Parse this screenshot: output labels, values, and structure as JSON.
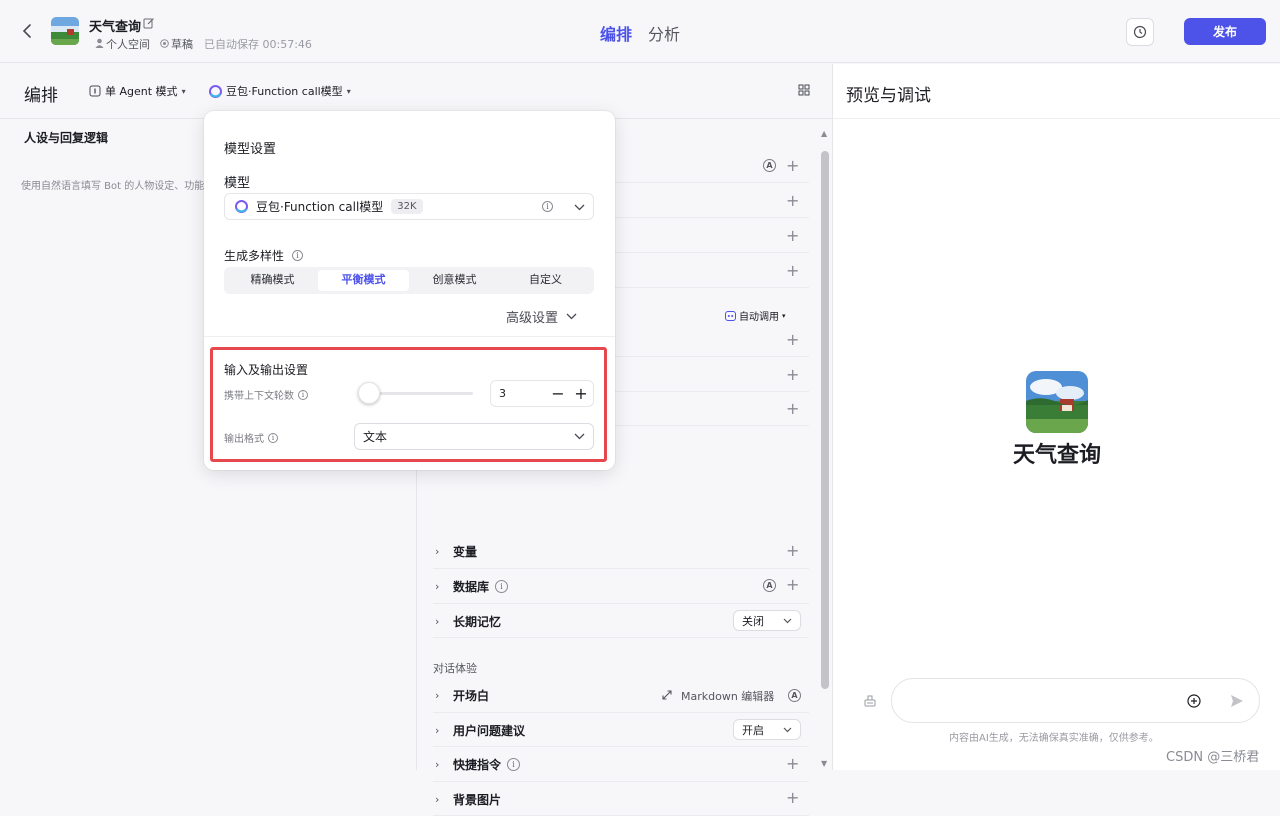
{
  "header": {
    "bot_name": "天气查询",
    "space": "个人空间",
    "status": "草稿",
    "autosave": "已自动保存 00:57:46",
    "tabs": [
      "编排",
      "分析"
    ],
    "publish_label": "发布"
  },
  "toolbar": {
    "title": "编排",
    "mode_label": "单 Agent 模式",
    "model_label": "豆包·Function call模型"
  },
  "left_section": {
    "title": "人设与回复逻辑",
    "placeholder": "使用自然语言填写 Bot 的人物设定、功能"
  },
  "skills": {
    "auto_call_label": "自动调用",
    "rows": [
      {
        "label": "变量"
      },
      {
        "label": "数据库"
      },
      {
        "label": "长期记忆",
        "select": "关闭"
      }
    ],
    "dialog_section_title": "对话体验",
    "dialog_rows": [
      {
        "label": "开场白",
        "extra": "Markdown 编辑器"
      },
      {
        "label": "用户问题建议",
        "select": "开启"
      },
      {
        "label": "快捷指令"
      },
      {
        "label": "背景图片"
      }
    ]
  },
  "popup": {
    "title": "模型设置",
    "model_section": "模型",
    "model_name": "豆包·Function call模型",
    "model_badge": "32K",
    "diversity_label": "生成多样性",
    "modes": [
      "精确模式",
      "平衡模式",
      "创意模式",
      "自定义"
    ],
    "active_mode": 1,
    "advanced_label": "高级设置",
    "io_title": "输入及输出设置",
    "context_label": "携带上下文轮数",
    "context_value": "3",
    "context_slider_fraction": 0.0,
    "output_label": "输出格式",
    "output_value": "文本"
  },
  "preview": {
    "title": "预览与调试",
    "bot_name": "天气查询",
    "disclaimer": "内容由AI生成，无法确保真实准确，仅供参考。",
    "watermark": "CSDN @三桥君"
  },
  "colors": {
    "accent": "#4d53e8",
    "highlight_border": "#e5484d"
  }
}
